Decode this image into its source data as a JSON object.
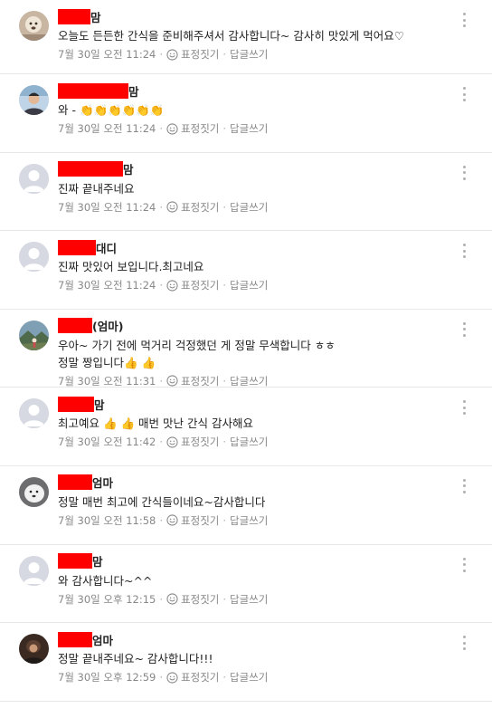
{
  "comments": [
    {
      "name_suffix": "맘",
      "redact_width": 36,
      "lines": [
        "오늘도 든든한 간식을 준비해주셔서 감사합니다~ 감사히 맛있게 먹어요♡"
      ],
      "time": "7월 30일 오전 11:24",
      "avatar": "photo-dog"
    },
    {
      "name_suffix": "맘",
      "redact_width": 78,
      "lines": [
        "와 - 👏👏👏👏👏👏"
      ],
      "time": "7월 30일 오전 11:24",
      "avatar": "photo-person"
    },
    {
      "name_suffix": "맘",
      "redact_width": 72,
      "lines": [
        "진짜 끝내주네요"
      ],
      "time": "7월 30일 오전 11:24",
      "avatar": "default"
    },
    {
      "name_suffix": "대디",
      "redact_width": 42,
      "lines": [
        "진짜 맛있어 보입니다.최고네요"
      ],
      "time": "7월 30일 오전 11:24",
      "avatar": "default"
    },
    {
      "name_suffix": "(엄마)",
      "redact_width": 38,
      "lines": [
        "우아~ 가기 전에 먹거리 걱정했던 게 정말 무색합니다 ㅎㅎ",
        "정말 짱입니다👍 👍"
      ],
      "time": "7월 30일 오전 11:31",
      "avatar": "photo-landscape"
    },
    {
      "name_suffix": "맘",
      "redact_width": 40,
      "lines": [
        "최고예요 👍 👍 매번 맛난 간식 감사해요"
      ],
      "time": "7월 30일 오전 11:42",
      "avatar": "default"
    },
    {
      "name_suffix": "엄마",
      "redact_width": 38,
      "lines": [
        "정말 매번 최고에 간식들이네요~감사합니다"
      ],
      "time": "7월 30일 오전 11:58",
      "avatar": "photo-white"
    },
    {
      "name_suffix": "맘",
      "redact_width": 38,
      "lines": [
        "와 감사합니다~^^"
      ],
      "time": "7월 30일 오후 12:15",
      "avatar": "default"
    },
    {
      "name_suffix": "엄마",
      "redact_width": 38,
      "lines": [
        "정말 끝내주네요~ 감사합니다!!!"
      ],
      "time": "7월 30일 오후 12:59",
      "avatar": "photo-dark"
    }
  ],
  "actions": {
    "emoji_label": "표정짓기",
    "reply_label": "답글쓰기",
    "separator": "·"
  },
  "icons": {
    "emoji": "smile-icon",
    "more": "more-vertical-icon"
  },
  "colors": {
    "redaction": "#ff0000",
    "meta_text": "#888888",
    "divider": "#e8e8e8"
  }
}
